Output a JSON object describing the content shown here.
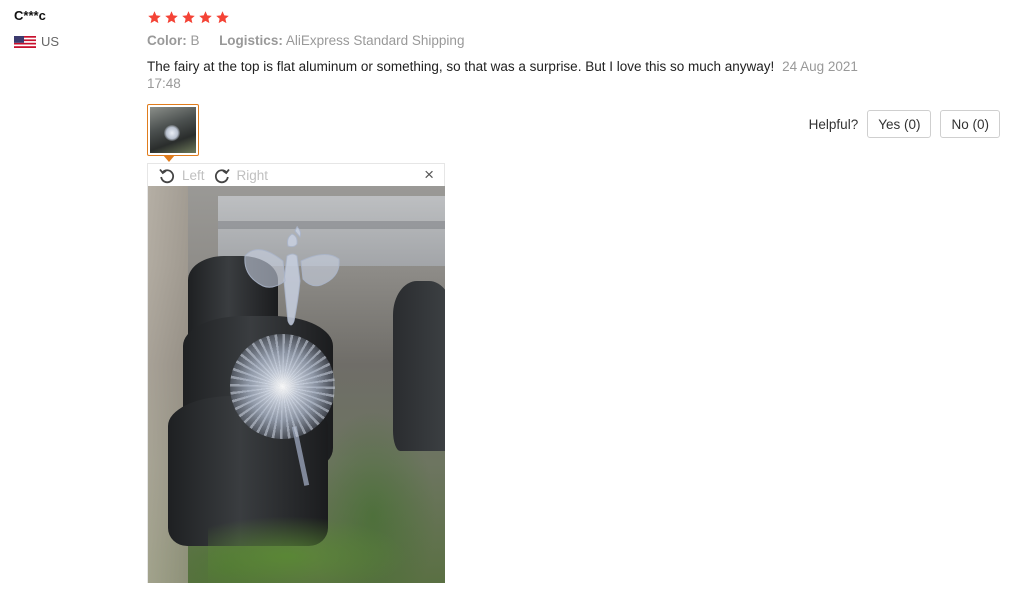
{
  "reviewer": {
    "name": "C***c",
    "country_code": "US",
    "flag_icon": "us-flag-icon"
  },
  "review": {
    "rating": 5,
    "rating_max": 5,
    "star_color": "#f44336",
    "color_label": "Color:",
    "color_value": "B",
    "logistics_label": "Logistics:",
    "logistics_value": "AliExpress Standard Shipping",
    "text": "The fairy at the top is flat aluminum or something, so that was a surprise. But I love this so much anyway!",
    "date": "24 Aug 2021",
    "time": "17:48"
  },
  "helpful": {
    "label": "Helpful?",
    "yes_label": "Yes (0)",
    "no_label": "No (0)"
  },
  "viewer": {
    "rotate_left_label": "Left",
    "rotate_right_label": "Right",
    "close_label": "×",
    "accent_color": "#e07c1c"
  }
}
